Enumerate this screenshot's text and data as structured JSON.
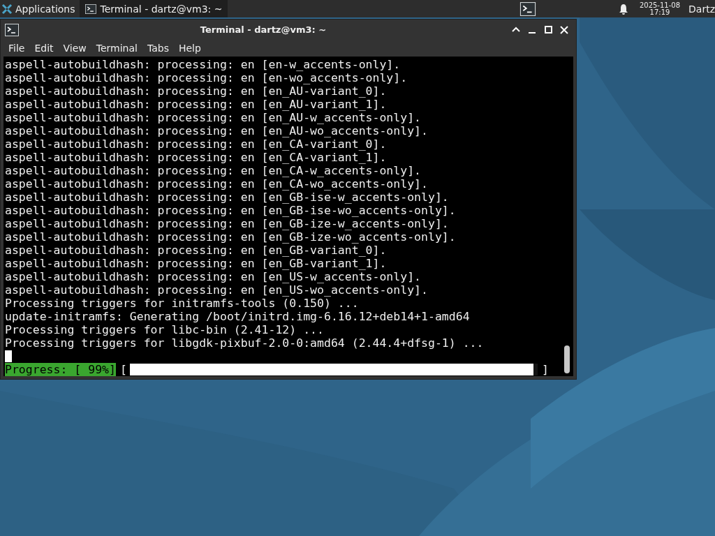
{
  "panel": {
    "apps_menu": "Applications",
    "tasks": [
      {
        "title": "Terminal - dartz@vm3: ~",
        "selected": true
      }
    ],
    "clock_date": "2025-11-08",
    "clock_time": "17:19",
    "user": "Dartz"
  },
  "window": {
    "title": "Terminal - dartz@vm3: ~",
    "menu": [
      "File",
      "Edit",
      "View",
      "Terminal",
      "Tabs",
      "Help"
    ],
    "lines": [
      "aspell-autobuildhash: processing: en [en-w_accents-only].",
      "aspell-autobuildhash: processing: en [en-wo_accents-only].",
      "aspell-autobuildhash: processing: en [en_AU-variant_0].",
      "aspell-autobuildhash: processing: en [en_AU-variant_1].",
      "aspell-autobuildhash: processing: en [en_AU-w_accents-only].",
      "aspell-autobuildhash: processing: en [en_AU-wo_accents-only].",
      "aspell-autobuildhash: processing: en [en_CA-variant_0].",
      "aspell-autobuildhash: processing: en [en_CA-variant_1].",
      "aspell-autobuildhash: processing: en [en_CA-w_accents-only].",
      "aspell-autobuildhash: processing: en [en_CA-wo_accents-only].",
      "aspell-autobuildhash: processing: en [en_GB-ise-w_accents-only].",
      "aspell-autobuildhash: processing: en [en_GB-ise-wo_accents-only].",
      "aspell-autobuildhash: processing: en [en_GB-ize-w_accents-only].",
      "aspell-autobuildhash: processing: en [en_GB-ize-wo_accents-only].",
      "aspell-autobuildhash: processing: en [en_GB-variant_0].",
      "aspell-autobuildhash: processing: en [en_GB-variant_1].",
      "aspell-autobuildhash: processing: en [en_US-w_accents-only].",
      "aspell-autobuildhash: processing: en [en_US-wo_accents-only].",
      "Processing triggers for initramfs-tools (0.150) ...",
      "update-initramfs: Generating /boot/initrd.img-6.16.12+deb14+1-amd64",
      "Processing triggers for libc-bin (2.41-12) ...",
      "Processing triggers for libgdk-pixbuf-2.0-0:amd64 (2.44.4+dfsg-1) ..."
    ],
    "progress": {
      "label": "Progress: [ 99%]",
      "open": "[",
      "close": "]",
      "level": 0.99
    }
  }
}
